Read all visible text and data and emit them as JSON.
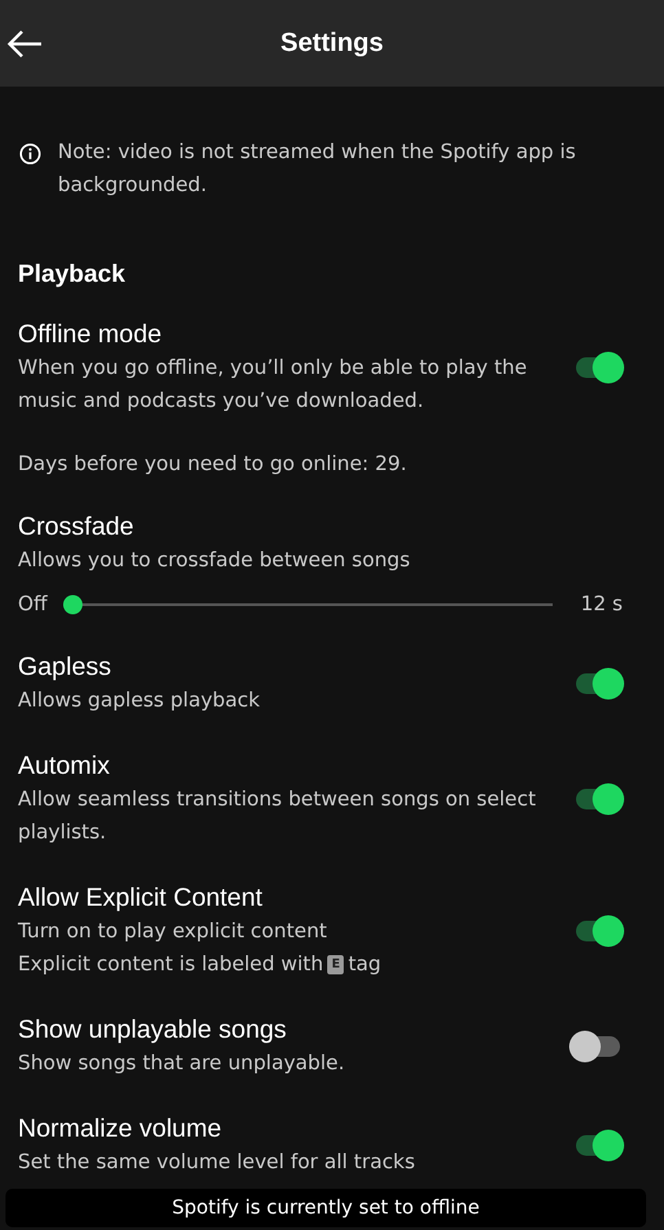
{
  "header": {
    "title": "Settings"
  },
  "note": "Note: video is not streamed when the Spotify app is backgrounded.",
  "section_title": "Playback",
  "settings": [
    {
      "kind": "toggle",
      "title": "Offline mode",
      "lines": [
        {
          "text": "When you go offline, you’ll only be able to play the music and podcasts you’ve downloaded."
        }
      ],
      "on": true
    },
    {
      "kind": "text",
      "lines": [
        {
          "text": "Days before you need to go online: 29."
        }
      ]
    },
    {
      "kind": "slider",
      "title": "Crossfade",
      "lines": [
        {
          "text": "Allows you to crossfade between songs"
        }
      ],
      "min_label": "Off",
      "max_label": "12 s",
      "level": 0
    },
    {
      "kind": "toggle",
      "title": "Gapless",
      "lines": [
        {
          "text": "Allows gapless playback"
        }
      ],
      "on": true
    },
    {
      "kind": "toggle",
      "title": "Automix",
      "lines": [
        {
          "text": "Allow seamless transitions between songs on select playlists."
        }
      ],
      "on": true
    },
    {
      "kind": "toggle",
      "title": "Allow Explicit Content",
      "lines": [
        {
          "text": "Turn on to play explicit content"
        },
        {
          "text": "Explicit content is labeled with",
          "badge": "E",
          "after": "tag"
        }
      ],
      "on": true
    },
    {
      "kind": "toggle",
      "title": "Show unplayable songs",
      "lines": [
        {
          "text": "Show songs that are unplayable."
        }
      ],
      "on": false
    },
    {
      "kind": "toggle",
      "title": "Normalize volume",
      "lines": [
        {
          "text": "Set the same volume level for all tracks"
        }
      ],
      "on": true
    }
  ],
  "toast": "Spotify is currently set to offline"
}
